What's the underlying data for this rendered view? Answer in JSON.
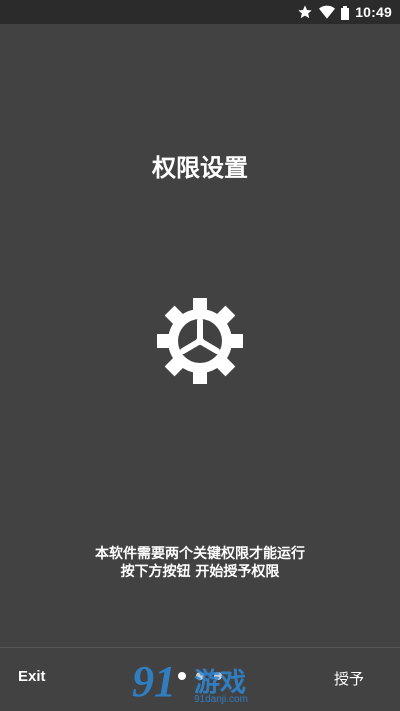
{
  "status_bar": {
    "time": "10:49",
    "icons": [
      "star-icon",
      "wifi-icon",
      "battery-icon"
    ]
  },
  "page": {
    "title": "权限设置",
    "icon": "settings-gear-icon",
    "message_line1": "本软件需要两个关键权限才能运行",
    "message_line2": "按下方按钮 开始授予权限"
  },
  "bottom_bar": {
    "exit_label": "Exit",
    "grant_label": "授予",
    "page_indicator": {
      "total": 3,
      "active": 1
    }
  },
  "watermark": {
    "number": "91",
    "text": "游戏",
    "url": "91danji.com"
  },
  "colors": {
    "background": "#424242",
    "status_bar": "#2b2b2b",
    "watermark": "#2f88d8"
  }
}
